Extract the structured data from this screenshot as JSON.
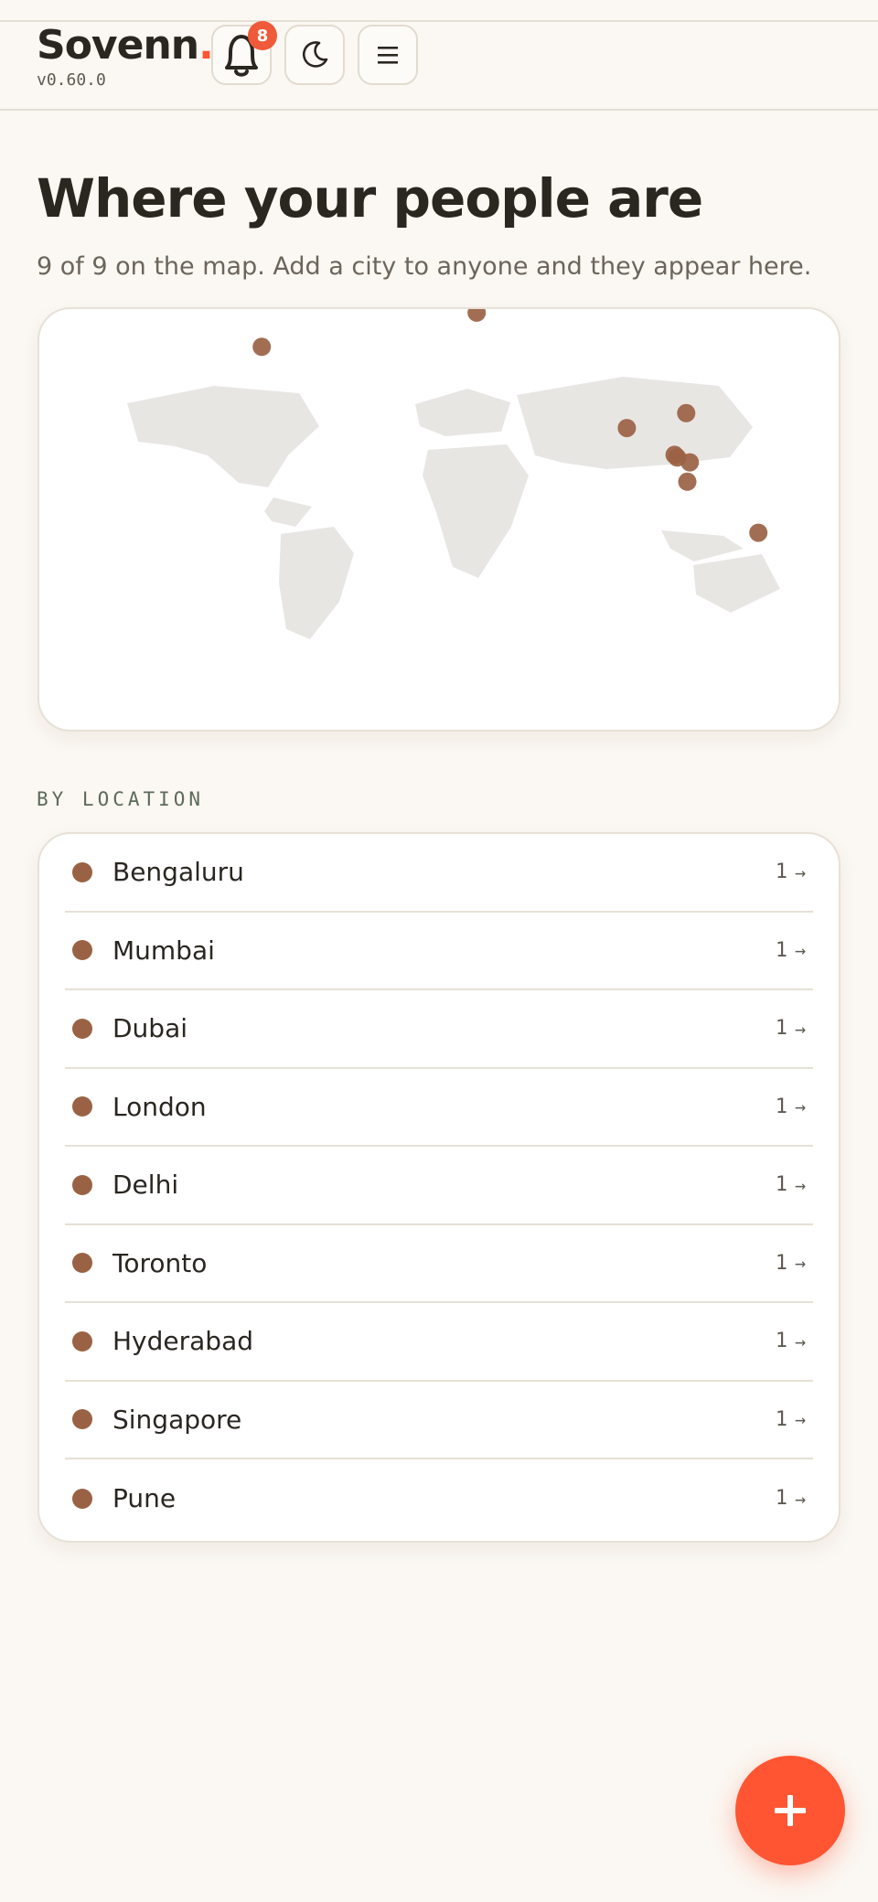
{
  "header": {
    "brand": "Sovenn",
    "brand_dot": ".",
    "version": "v0.60.0",
    "notifications_count": "8",
    "icons": {
      "notifications": "bell-icon",
      "theme": "moon-icon",
      "menu": "hamburger-menu-icon"
    }
  },
  "page": {
    "title": "Where your people are",
    "subtitle": "9 of 9 on the map. Add a city to anyone and they appear here."
  },
  "map": {
    "markers": [
      {
        "city": "Toronto",
        "lat": 43.7,
        "lon": -79.4
      },
      {
        "city": "London",
        "lat": 51.5,
        "lon": -0.1
      },
      {
        "city": "Dubai",
        "lat": 25.2,
        "lon": 55.3
      },
      {
        "city": "Delhi",
        "lat": 28.6,
        "lon": 77.2
      },
      {
        "city": "Mumbai",
        "lat": 19.1,
        "lon": 72.9
      },
      {
        "city": "Pune",
        "lat": 18.5,
        "lon": 73.9
      },
      {
        "city": "Hyderabad",
        "lat": 17.4,
        "lon": 78.5
      },
      {
        "city": "Bengaluru",
        "lat": 12.97,
        "lon": 77.6
      },
      {
        "city": "Singapore",
        "lat": 1.35,
        "lon": 103.8
      }
    ]
  },
  "locations": {
    "section_label": "BY LOCATION",
    "items": [
      {
        "name": "Bengaluru",
        "count": "1"
      },
      {
        "name": "Mumbai",
        "count": "1"
      },
      {
        "name": "Dubai",
        "count": "1"
      },
      {
        "name": "London",
        "count": "1"
      },
      {
        "name": "Delhi",
        "count": "1"
      },
      {
        "name": "Toronto",
        "count": "1"
      },
      {
        "name": "Hyderabad",
        "count": "1"
      },
      {
        "name": "Singapore",
        "count": "1"
      },
      {
        "name": "Pune",
        "count": "1"
      }
    ],
    "arrow": "→"
  },
  "fab": {
    "icon": "plus-icon"
  },
  "colors": {
    "accent": "#ff5533",
    "marker": "#9a6244",
    "land": "#e8e6e3",
    "background": "#fbf7f2"
  }
}
